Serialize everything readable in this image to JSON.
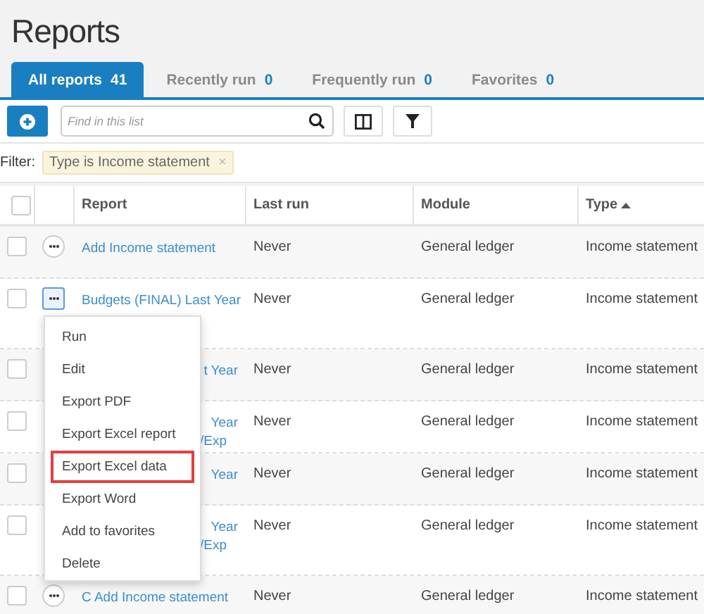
{
  "page": {
    "title": "Reports"
  },
  "tabs": [
    {
      "label": "All reports",
      "count": "41",
      "selected": true
    },
    {
      "label": "Recently run",
      "count": "0",
      "selected": false
    },
    {
      "label": "Frequently run",
      "count": "0",
      "selected": false
    },
    {
      "label": "Favorites",
      "count": "0",
      "selected": false
    }
  ],
  "search": {
    "placeholder": "Find in this list"
  },
  "filter": {
    "label": "Filter:",
    "chip": "Type is Income statement",
    "remove": "×"
  },
  "table": {
    "all_checked": false,
    "columns": [
      {
        "label": "Report",
        "sorted": false
      },
      {
        "label": "Last run",
        "sorted": false
      },
      {
        "label": "Module",
        "sorted": false
      },
      {
        "label": "Type",
        "sorted": true
      }
    ],
    "rows": [
      {
        "report": [
          "Add Income statement"
        ],
        "checked": false,
        "covered": false,
        "tall": false,
        "active": false,
        "last_run": "Never",
        "module": "General ledger",
        "type": "Income statement"
      },
      {
        "report": [
          "Budgets (FINAL) Last Year"
        ],
        "checked": false,
        "covered": false,
        "tall": true,
        "active": true,
        "last_run": "Never",
        "module": "General ledger",
        "type": "Income statement"
      },
      {
        "report": [
          "t Year"
        ],
        "checked": false,
        "covered": true,
        "tall": false,
        "last_run": "Never",
        "module": "General ledger",
        "type": "Income statement"
      },
      {
        "report": [
          "Year",
          "/Exp"
        ],
        "checked": false,
        "covered": true,
        "tall": false,
        "last_run": "Never",
        "module": "General ledger",
        "type": "Income statement"
      },
      {
        "report": [
          "Year"
        ],
        "checked": false,
        "covered": true,
        "tall": false,
        "last_run": "Never",
        "module": "General ledger",
        "type": "Income statement"
      },
      {
        "report": [
          "Year",
          "/Exp"
        ],
        "checked": false,
        "covered": true,
        "tall": true,
        "last_run": "Never",
        "module": "General ledger",
        "type": "Income statement"
      },
      {
        "report": [
          "C Add Income statement"
        ],
        "checked": false,
        "covered": false,
        "active": false,
        "last_run": "Never",
        "module": "General ledger",
        "type": "Income statement"
      }
    ]
  },
  "menu": [
    {
      "label": "Run",
      "highlighted": false
    },
    {
      "label": "Edit",
      "highlighted": false
    },
    {
      "label": "Export PDF",
      "highlighted": false
    },
    {
      "label": "Export Excel report",
      "highlighted": false
    },
    {
      "label": "Export Excel data",
      "highlighted": true
    },
    {
      "label": "Export Word",
      "highlighted": false
    },
    {
      "label": "Add to favorites",
      "highlighted": false
    },
    {
      "label": "Delete",
      "highlighted": false
    }
  ]
}
